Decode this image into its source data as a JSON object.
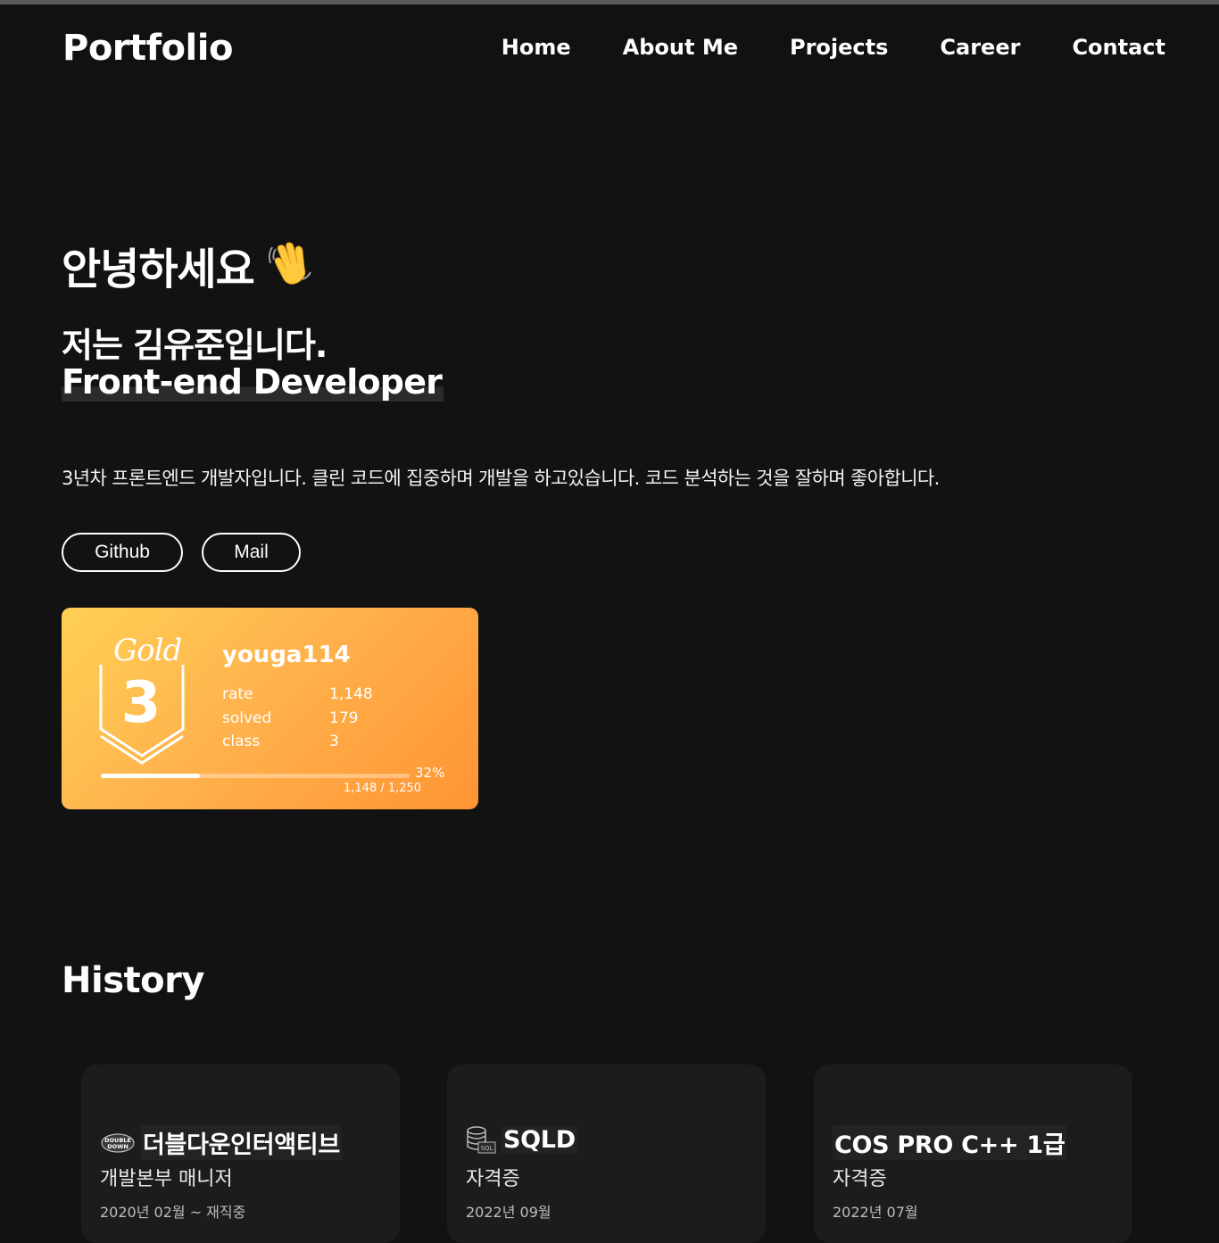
{
  "header": {
    "logo": "Portfolio",
    "nav": [
      "Home",
      "About Me",
      "Projects",
      "Career",
      "Contact"
    ]
  },
  "hero": {
    "greeting": "안녕하세요",
    "greeting_icon": "waving-hand-icon",
    "line1": "저는 김유준입니다.",
    "line2": "Front-end Developer",
    "description": "3년차 프론트엔드 개발자입니다. 클린 코드에 집중하며 개발을 하고있습니다. 코드 분석하는 것을 잘하며 좋아합니다.",
    "buttons": {
      "github": "Github",
      "mail": "Mail"
    }
  },
  "solved_card": {
    "tier_name": "Gold",
    "tier_number": "3",
    "handle": "youga114",
    "stats": [
      {
        "label": "rate",
        "value": "1,148"
      },
      {
        "label": "solved",
        "value": "179"
      },
      {
        "label": "class",
        "value": "3"
      }
    ],
    "progress_percent": 32,
    "progress_percent_label": "32%",
    "progress_text": "1,148 / 1,250",
    "colors": {
      "start": "#ffd054",
      "end": "#ff9433"
    }
  },
  "history": {
    "title": "History",
    "cards": [
      {
        "title": "더블다운인터액티브",
        "subtitle": "개발본부 매니저",
        "date": "2020년 02월 ~ 재직중",
        "icon": "doubledown-logo-icon",
        "logo_text": [
          "DOUBLE",
          "DOWN"
        ]
      },
      {
        "title": "SQLD",
        "subtitle": "자격증",
        "date": "2022년 09월",
        "icon": "database-sql-icon",
        "logo_text": [
          "SQL"
        ]
      },
      {
        "title": "COS PRO C++ 1급",
        "subtitle": "자격증",
        "date": "2022년 07월",
        "icon": ""
      }
    ]
  },
  "colors": {
    "background": "#121212",
    "card": "#1c1c1c",
    "text": "#ffffff"
  }
}
